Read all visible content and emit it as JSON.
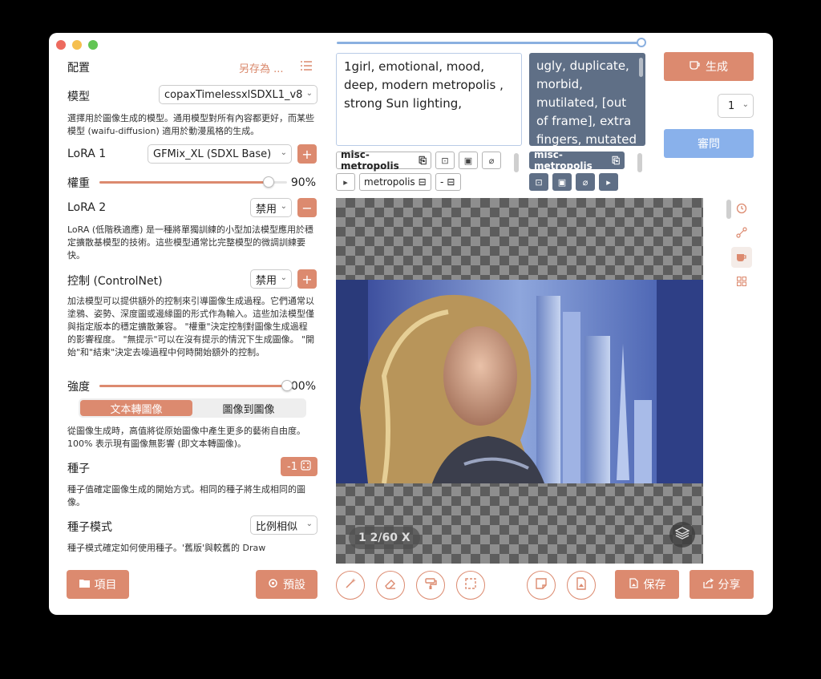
{
  "left": {
    "config_label": "配置",
    "save_as": "另存為 ...",
    "model_label": "模型",
    "model_value": "copaxTimelessxlSDXL1_v8",
    "model_desc": "選擇用於圖像生成的模型。通用模型對所有內容都更好，而某些模型 (waifu-diffusion) 適用於動漫風格的生成。",
    "lora1_label": "LoRA 1",
    "lora1_value": "GFMix_XL (SDXL Base)",
    "weight_label": "權重",
    "weight_value": "90%",
    "weight_fraction": 0.9,
    "lora2_label": "LoRA 2",
    "lora2_value": "禁用",
    "lora_desc": "LoRA (低階秩適應) 是一種將單獨訓練的小型加法模型應用於穩定擴散基模型的技術。這些模型通常比完整模型的微調訓練要快。",
    "control_label": "控制 (ControlNet)",
    "control_value": "禁用",
    "control_desc": "加法模型可以提供額外的控制來引導圖像生成過程。它們通常以塗鴉、姿勢、深度圖或邊緣圖的形式作為輸入。這些加法模型僅與指定版本的穩定擴散兼容。 \"權重\"決定控制對圖像生成過程的影響程度。 \"無提示\"可以在沒有提示的情況下生成圖像。 \"開始\"和\"結束\"決定去噪過程中何時開始額外的控制。",
    "strength_label": "強度",
    "strength_value": "100%",
    "strength_fraction": 1.0,
    "mode_tabs": [
      "文本轉圖像",
      "圖像到圖像"
    ],
    "strength_desc": "從圖像生成時，高值將從原始圖像中產生更多的藝術自由度。100% 表示現有圖像無影響 (即文本轉圖像)。",
    "seed_label": "種子",
    "seed_value": "-1",
    "seed_desc": "種子值確定圖像生成的開始方式。相同的種子將生成相同的圖像。",
    "seed_mode_label": "種子模式",
    "seed_mode_value": "比例相似",
    "seed_mode_desc": "種子模式確定如何使用種子。'舊版'與較舊的 Draw",
    "projects_btn": "項目",
    "presets_btn": "預設"
  },
  "prompt": {
    "positive": "1girl, emotional, mood, deep, modern metropolis , strong Sun lighting,",
    "negative": "ugly, duplicate, morbid, mutilated, [out of frame], extra fingers, mutated",
    "pos_tag": "misc-metropolis",
    "pos_tag2": "metropolis",
    "pos_tag3": "-",
    "neg_tag": "misc-metropolis"
  },
  "right": {
    "generate_btn": "生成",
    "count_value": "1",
    "ask_btn": "審問",
    "zoom_text": "1 2/60 X",
    "save_btn": "保存",
    "share_btn": "分享"
  },
  "colors": {
    "accent": "#dc8a6f",
    "ask_button": "#89b1eb",
    "negative_bg": "#5f6f86"
  }
}
